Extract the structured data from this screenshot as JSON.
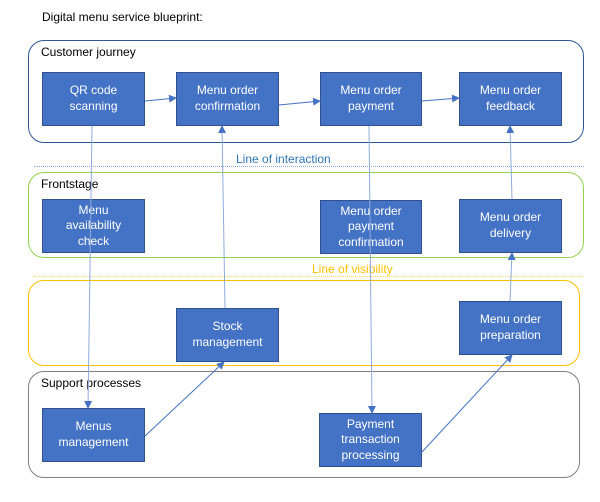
{
  "title": "Digital menu service blueprint:",
  "colors": {
    "box_fill": "#4472c4",
    "box_border": "#2f528f",
    "customer_lane": "#2f5597",
    "frontstage_lane": "#92d050",
    "backstage_lane": "#ffc000",
    "support_lane": "#7f7f7f",
    "interaction_line": "#2e75b6",
    "visibility_line": "#ffc000",
    "arrow": "#4472c4"
  },
  "lanes": {
    "customer": {
      "label": "Customer journey"
    },
    "frontstage": {
      "label": "Frontstage"
    },
    "backstage": {
      "label": ""
    },
    "support": {
      "label": "Support processes"
    }
  },
  "dividers": {
    "interaction": "Line of interaction",
    "visibility": "Line of visibility"
  },
  "boxes": {
    "qr": "QR code\nscanning",
    "confirm": "Menu order\nconfirmation",
    "payment": "Menu order\npayment",
    "feedback": "Menu order\nfeedback",
    "availability": "Menu\navailability\ncheck",
    "payconfirm": "Menu order\npayment\nconfirmation",
    "delivery": "Menu order\ndelivery",
    "stock": "Stock\nmanagement",
    "preparation": "Menu order\npreparation",
    "menus": "Menus\nmanagement",
    "transaction": "Payment\ntransaction\nprocessing"
  },
  "connections": [
    {
      "from": "qr",
      "to": "confirm"
    },
    {
      "from": "confirm",
      "to": "payment"
    },
    {
      "from": "payment",
      "to": "feedback"
    },
    {
      "from": "qr",
      "to": "menus"
    },
    {
      "from": "menus",
      "to": "stock"
    },
    {
      "from": "stock",
      "to": "confirm"
    },
    {
      "from": "payment",
      "to": "transaction"
    },
    {
      "from": "transaction",
      "to": "preparation"
    },
    {
      "from": "preparation",
      "to": "delivery"
    },
    {
      "from": "delivery",
      "to": "feedback"
    }
  ]
}
